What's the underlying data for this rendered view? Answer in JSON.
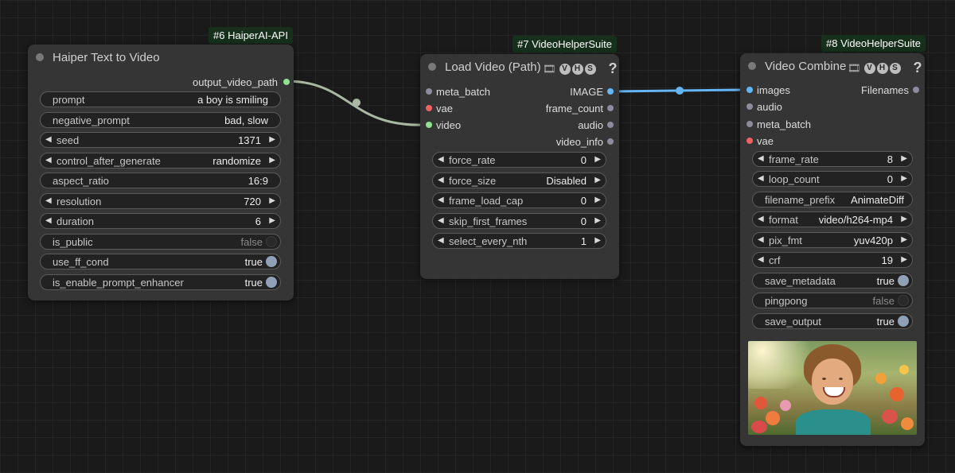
{
  "nodes": {
    "haiper": {
      "badge": "#6 HaiperAI-API",
      "title": "Haiper Text to Video",
      "outputs": [
        "output_video_path"
      ],
      "widgets": {
        "prompt": {
          "label": "prompt",
          "value": "a boy is smiling"
        },
        "negative_prompt": {
          "label": "negative_prompt",
          "value": "bad, slow"
        },
        "seed": {
          "label": "seed",
          "value": "1371"
        },
        "control_after_generate": {
          "label": "control_after_generate",
          "value": "randomize"
        },
        "aspect_ratio": {
          "label": "aspect_ratio",
          "value": "16:9"
        },
        "resolution": {
          "label": "resolution",
          "value": "720"
        },
        "duration": {
          "label": "duration",
          "value": "6"
        },
        "is_public": {
          "label": "is_public",
          "value": "false"
        },
        "use_ff_cond": {
          "label": "use_ff_cond",
          "value": "true"
        },
        "is_enable_prompt_enhancer": {
          "label": "is_enable_prompt_enhancer",
          "value": "true"
        }
      }
    },
    "load_video": {
      "badge": "#7 VideoHelperSuite",
      "title": "Load Video (Path)",
      "vhs": [
        "V",
        "H",
        "S"
      ],
      "help": "?",
      "inputs": [
        "meta_batch",
        "vae",
        "video"
      ],
      "outputs": [
        "IMAGE",
        "frame_count",
        "audio",
        "video_info"
      ],
      "widgets": {
        "force_rate": {
          "label": "force_rate",
          "value": "0"
        },
        "force_size": {
          "label": "force_size",
          "value": "Disabled"
        },
        "frame_load_cap": {
          "label": "frame_load_cap",
          "value": "0"
        },
        "skip_first_frames": {
          "label": "skip_first_frames",
          "value": "0"
        },
        "select_every_nth": {
          "label": "select_every_nth",
          "value": "1"
        }
      }
    },
    "video_combine": {
      "badge": "#8 VideoHelperSuite",
      "title": "Video Combine",
      "vhs": [
        "V",
        "H",
        "S"
      ],
      "help": "?",
      "inputs": [
        "images",
        "audio",
        "meta_batch",
        "vae"
      ],
      "outputs": [
        "Filenames"
      ],
      "widgets": {
        "frame_rate": {
          "label": "frame_rate",
          "value": "8"
        },
        "loop_count": {
          "label": "loop_count",
          "value": "0"
        },
        "filename_prefix": {
          "label": "filename_prefix",
          "value": "AnimateDiff"
        },
        "format": {
          "label": "format",
          "value": "video/h264-mp4"
        },
        "pix_fmt": {
          "label": "pix_fmt",
          "value": "yuv420p"
        },
        "crf": {
          "label": "crf",
          "value": "19"
        },
        "save_metadata": {
          "label": "save_metadata",
          "value": "true"
        },
        "pingpong": {
          "label": "pingpong",
          "value": "false"
        },
        "save_output": {
          "label": "save_output",
          "value": "true"
        }
      }
    }
  },
  "colors": {
    "link_video": "#a9b8a3",
    "link_image": "#64b5f6",
    "slot_image": "#64b5f6",
    "slot_vae": "#f06262",
    "slot_video": "#8fe08f",
    "slot_generic": "#8c8c9c",
    "badge_bg": "#16301c",
    "node_bg": "#353535"
  },
  "icons": {
    "vhs_film": "film-icon"
  }
}
